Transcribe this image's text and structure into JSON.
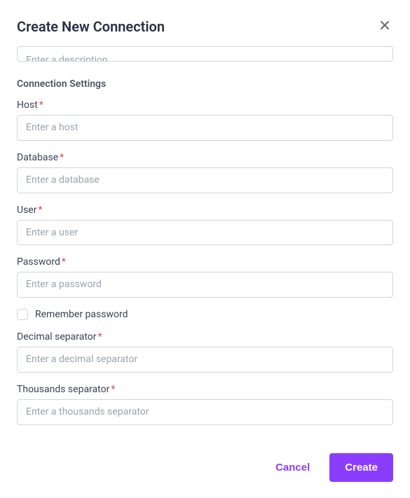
{
  "modal": {
    "title": "Create New Connection"
  },
  "description": {
    "placeholder": "Enter a description",
    "value": ""
  },
  "section": {
    "title": "Connection Settings"
  },
  "fields": {
    "host": {
      "label": "Host",
      "placeholder": "Enter a host",
      "value": ""
    },
    "database": {
      "label": "Database",
      "placeholder": "Enter a database",
      "value": ""
    },
    "user": {
      "label": "User",
      "placeholder": "Enter a user",
      "value": ""
    },
    "password": {
      "label": "Password",
      "placeholder": "Enter a password",
      "value": ""
    },
    "remember": {
      "label": "Remember password",
      "checked": false
    },
    "decimal": {
      "label": "Decimal separator",
      "placeholder": "Enter a decimal separator",
      "value": ""
    },
    "thousands": {
      "label": "Thousands separator",
      "placeholder": "Enter a thousands separator",
      "value": ""
    }
  },
  "footer": {
    "cancel": "Cancel",
    "create": "Create"
  },
  "asterisk": "*"
}
